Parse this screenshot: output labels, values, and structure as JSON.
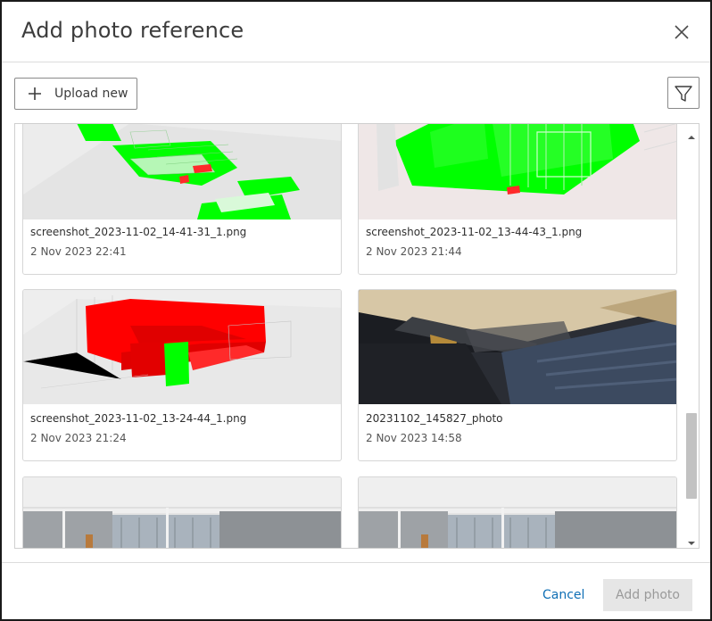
{
  "dialog": {
    "title": "Add photo reference",
    "close_icon": "close-icon"
  },
  "toolbar": {
    "upload_label": "Upload new",
    "upload_icon": "plus-icon",
    "filter_icon": "filter-icon"
  },
  "photos": [
    {
      "name": "screenshot_2023-11-02_14-41-31_1.png",
      "date": "2 Nov 2023 22:41"
    },
    {
      "name": "screenshot_2023-11-02_13-44-43_1.png",
      "date": "2 Nov 2023 21:44"
    },
    {
      "name": "screenshot_2023-11-02_13-24-44_1.png",
      "date": "2 Nov 2023 21:24"
    },
    {
      "name": "20231102_145827_photo",
      "date": "2 Nov 2023 14:58"
    }
  ],
  "footer": {
    "cancel_label": "Cancel",
    "add_label": "Add photo"
  },
  "colors": {
    "accent": "#0f6fb5",
    "disabled_bg": "#e6e6e6",
    "disabled_text": "#9a9a9a",
    "model_green": "#00ff00",
    "model_red": "#ff0000"
  }
}
